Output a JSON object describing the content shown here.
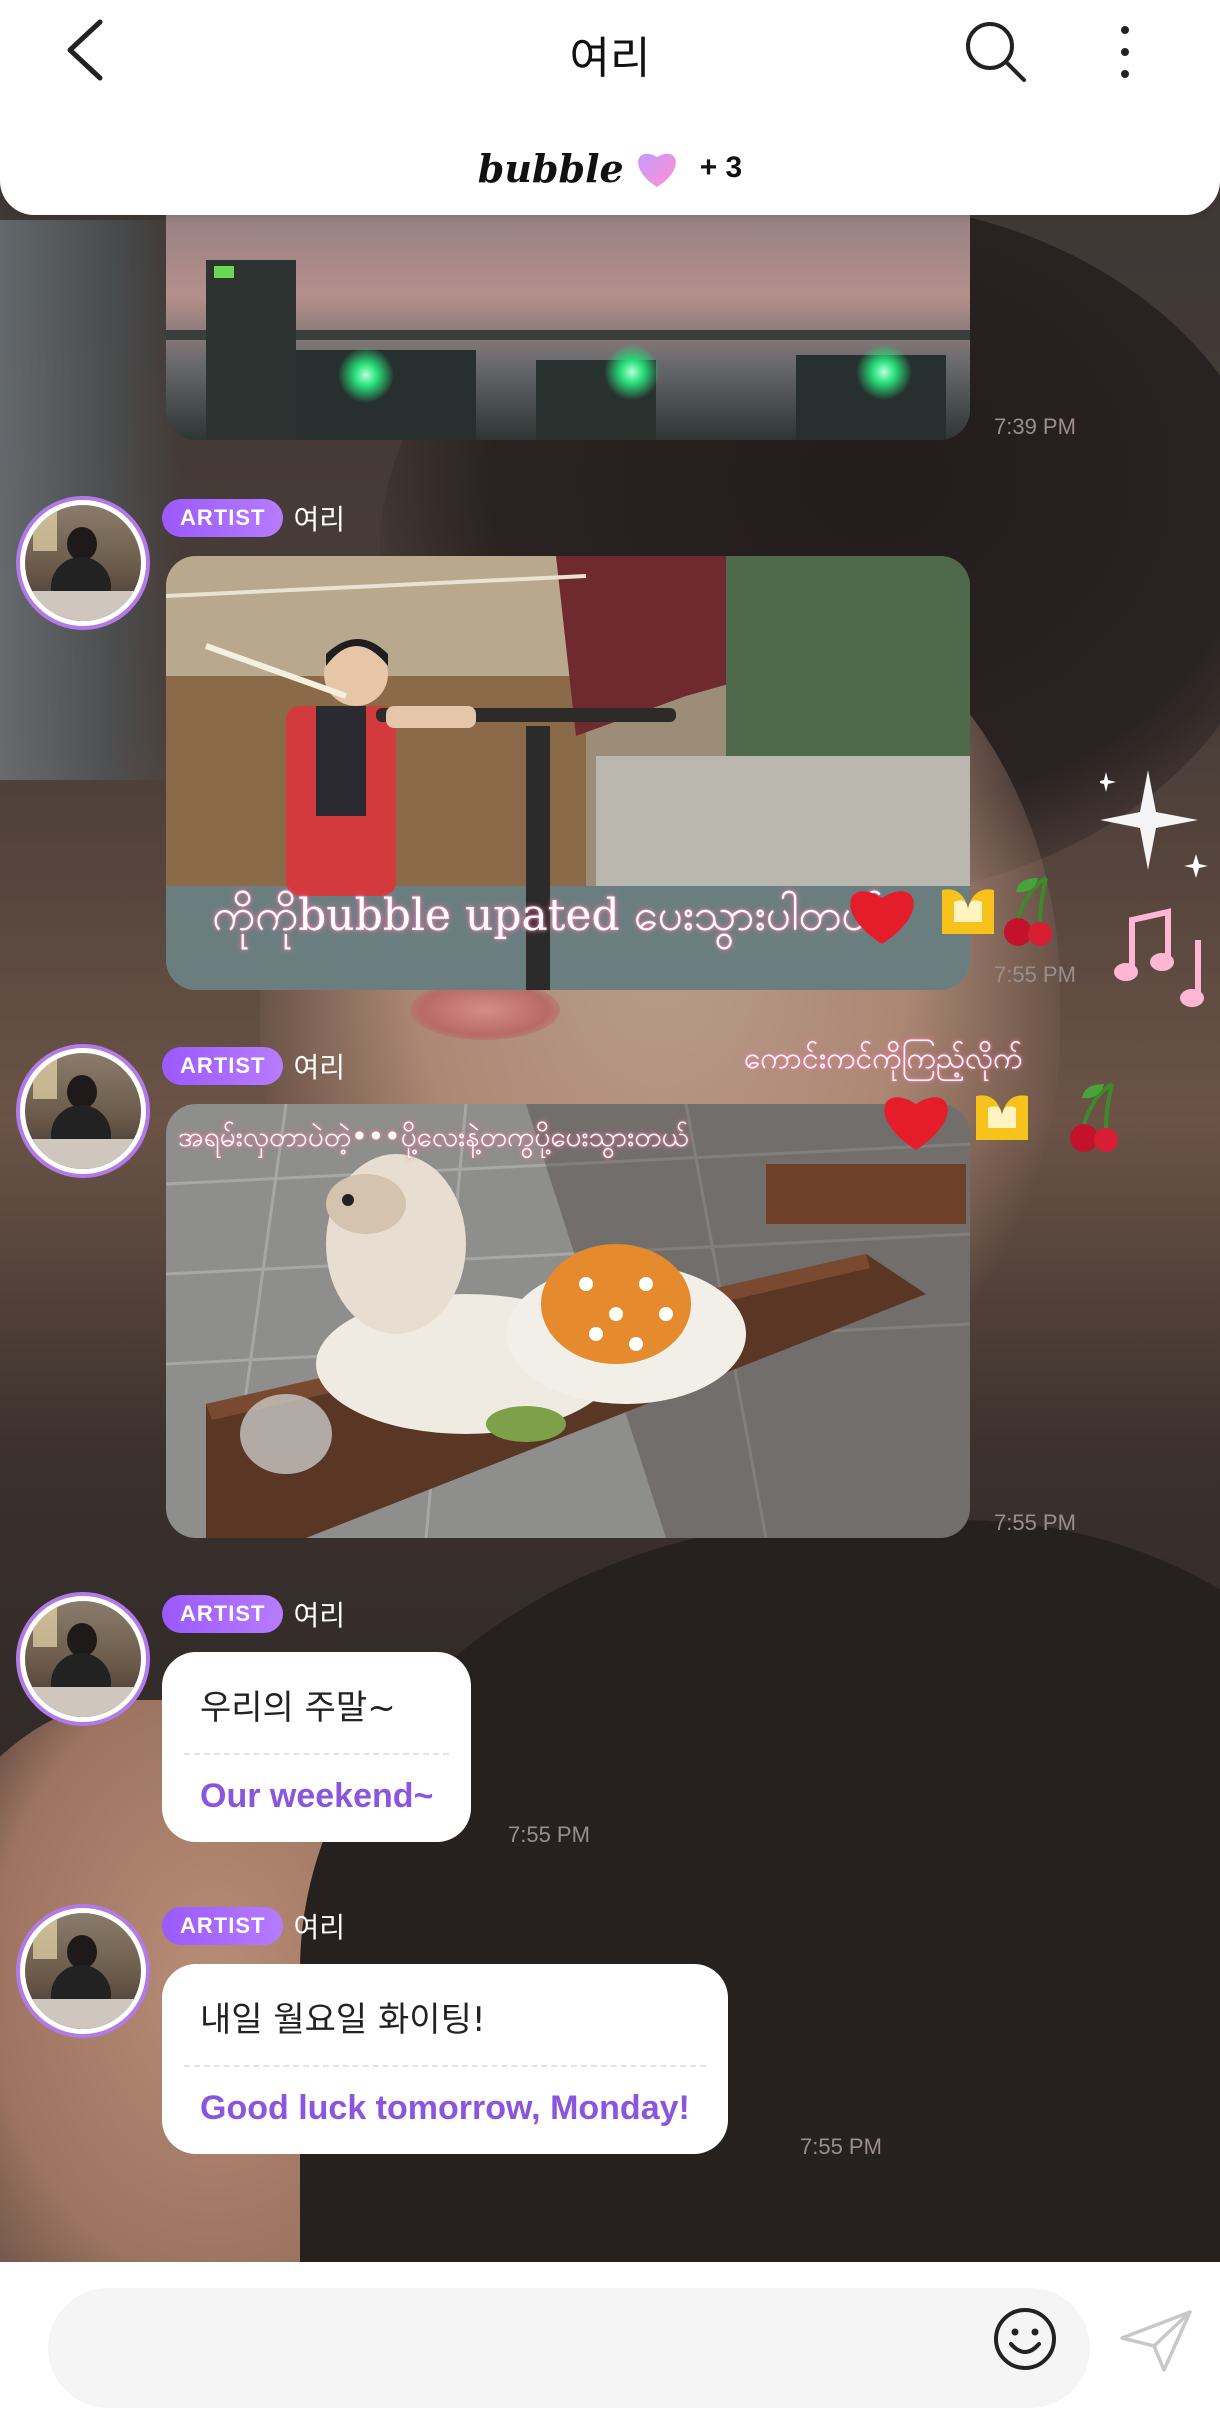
{
  "header": {
    "title": "여리",
    "brand_word": "bubble",
    "brand_plus": "+ 3",
    "accent": "#9b59ff"
  },
  "icons": {
    "back": "chevron-left-icon",
    "search": "search-icon",
    "more": "more-vertical-icon",
    "heart": "heart-icon",
    "emoji": "smiley-icon",
    "send": "paper-plane-icon"
  },
  "messages": [
    {
      "type": "image",
      "subject": "sky with traffic lights",
      "time": "7:39 PM"
    },
    {
      "type": "image",
      "sender_badge": "ARTIST",
      "sender": "여리",
      "subject": "person at shooting range",
      "time": "7:55 PM"
    },
    {
      "type": "image",
      "sender_badge": "ARTIST",
      "sender": "여리",
      "subject": "white dog on bench",
      "time": "7:55 PM"
    },
    {
      "type": "text",
      "sender_badge": "ARTIST",
      "sender": "여리",
      "korean": "우리의 주말~",
      "english": "Our weekend~",
      "time": "7:55 PM"
    },
    {
      "type": "text",
      "sender_badge": "ARTIST",
      "sender": "여리",
      "korean": "내일 월요일 화이팅!",
      "english": "Good luck tomorrow, Monday!",
      "time": "7:55 PM"
    }
  ],
  "overlay_captions": {
    "line1": "ကိုကိုbubble upated ပေးသွားပါတယ်",
    "line2": "ကောင်းကင်ကိုကြည့်လိုက်",
    "line3": "အရမ်းလှတာပဲတဲ့•••ပို့လေးနဲ့တကွပို့ပေးသွားတယ်"
  },
  "input": {
    "placeholder": ""
  }
}
